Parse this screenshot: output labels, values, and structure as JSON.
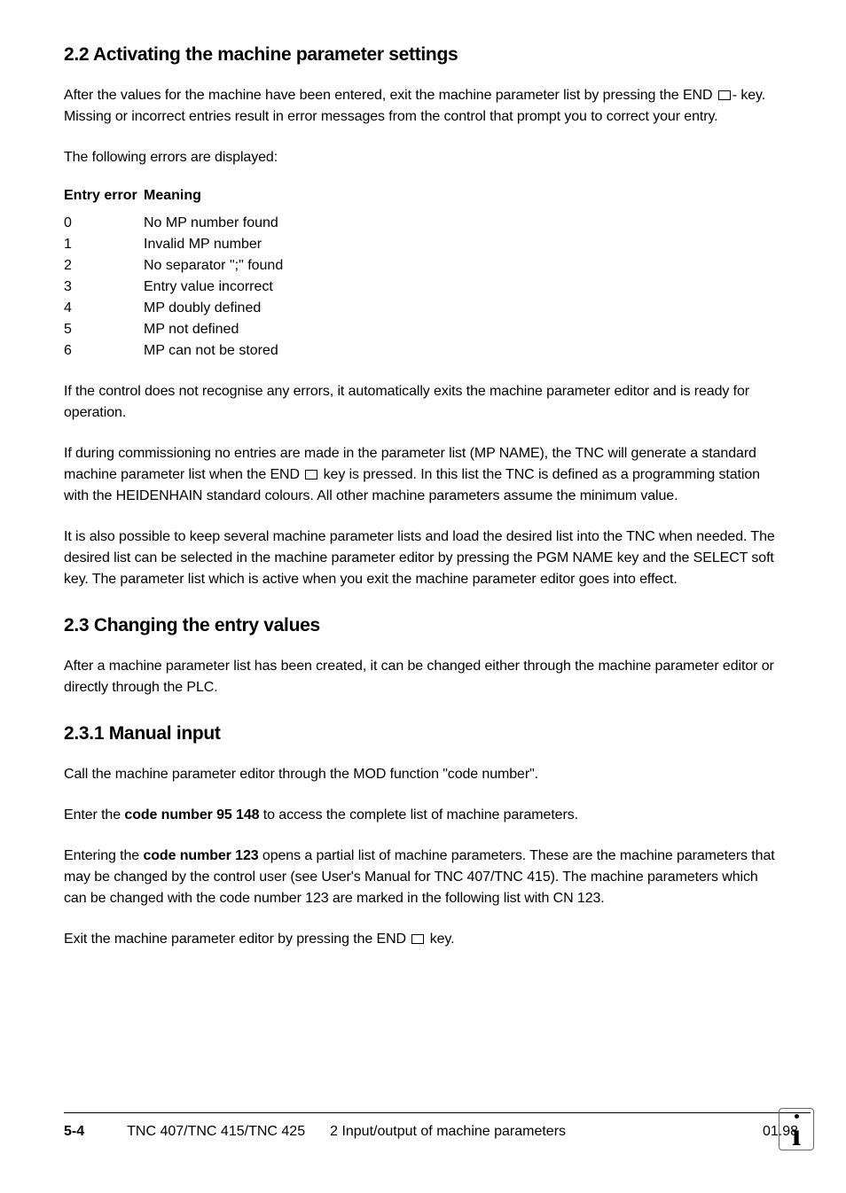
{
  "headings": {
    "h22": "2.2  Activating the machine parameter settings",
    "h23": "2.3  Changing the entry values",
    "h231": "2.3.1  Manual input"
  },
  "paragraphs": {
    "p1a": "After the values for the machine have been entered, exit the machine parameter list by pressing the END ",
    "p1b": "- key.  Missing or incorrect entries result in error messages from the control that prompt you to correct your entry.",
    "p2": "The following errors are displayed:",
    "p3": "If the control does not recognise any errors, it automatically exits the machine parameter editor and is ready for operation.",
    "p4a": "If during commissioning no entries are made in the parameter list (MP NAME), the TNC will generate a standard machine parameter list when the END ",
    "p4b": "  key is pressed.  In this list the TNC is defined as a programming station with the HEIDENHAIN standard colours.  All other machine parameters assume the minimum value.",
    "p5": "It is also possible to keep several machine parameter lists and load the desired list into the TNC when needed.  The desired list can be selected in the machine parameter editor by pressing the PGM NAME key and the SELECT soft key.  The parameter list which is active when you exit the machine parameter editor goes into effect.",
    "p6": "After a machine parameter list has been created, it can be changed either through the machine parameter editor or directly through the PLC.",
    "p7": "Call the machine parameter editor through the MOD function \"code number\".",
    "p8a": "Enter the ",
    "p8b": "code number 95 148",
    "p8c": " to access the complete list of machine parameters.",
    "p9a": "Entering the ",
    "p9b": "code number 123",
    "p9c": " opens a partial list of machine parameters.  These are the machine parameters that may be changed by the control user (see User's Manual for TNC 407/TNC 415).  The machine parameters which can be changed with the code number 123 are marked in the following list with CN 123.",
    "p10a": "Exit the machine parameter editor by pressing the END ",
    "p10b": "  key."
  },
  "table": {
    "header": {
      "col1": "Entry error",
      "col2": "Meaning"
    },
    "rows": [
      {
        "code": "0",
        "meaning": "No MP number found"
      },
      {
        "code": "1",
        "meaning": "Invalid MP number"
      },
      {
        "code": "2",
        "meaning": "No separator \";\" found"
      },
      {
        "code": "3",
        "meaning": "Entry value incorrect"
      },
      {
        "code": "4",
        "meaning": "MP doubly defined"
      },
      {
        "code": "5",
        "meaning": "MP not defined"
      },
      {
        "code": "6",
        "meaning": "MP can not be stored"
      }
    ]
  },
  "footer": {
    "page": "5-4",
    "doc": "TNC 407/TNC 415/TNC 425",
    "section": "2  Input/output of machine parameters",
    "date": "01.98"
  }
}
